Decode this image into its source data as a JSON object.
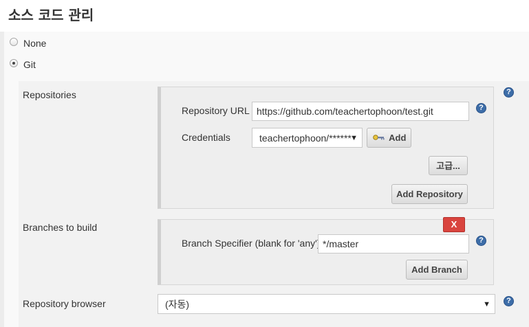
{
  "section": {
    "title": "소스 코드 관리"
  },
  "scm_options": [
    {
      "label": "None",
      "checked": false
    },
    {
      "label": "Git",
      "checked": true
    }
  ],
  "git": {
    "repositories_label": "Repositories",
    "repository_url_label": "Repository URL",
    "repository_url_value": "https://github.com/teachertophoon/test.git",
    "credentials_label": "Credentials",
    "credentials_value": "teachertophoon/******",
    "add_label": "Add",
    "advanced_label": "고급...",
    "add_repository_label": "Add Repository",
    "branches_label": "Branches to build",
    "remove_label": "X",
    "branch_specifier_label": "Branch Specifier (blank for 'any')",
    "branch_specifier_value": "*/master",
    "add_branch_label": "Add Branch",
    "repository_browser_label": "Repository browser",
    "repository_browser_value": "(자동)"
  },
  "icons": {
    "help": "?",
    "caret": "▼",
    "key": "key-icon"
  },
  "colors": {
    "help_blue": "#3d6da8",
    "remove_red": "#d9443e"
  }
}
